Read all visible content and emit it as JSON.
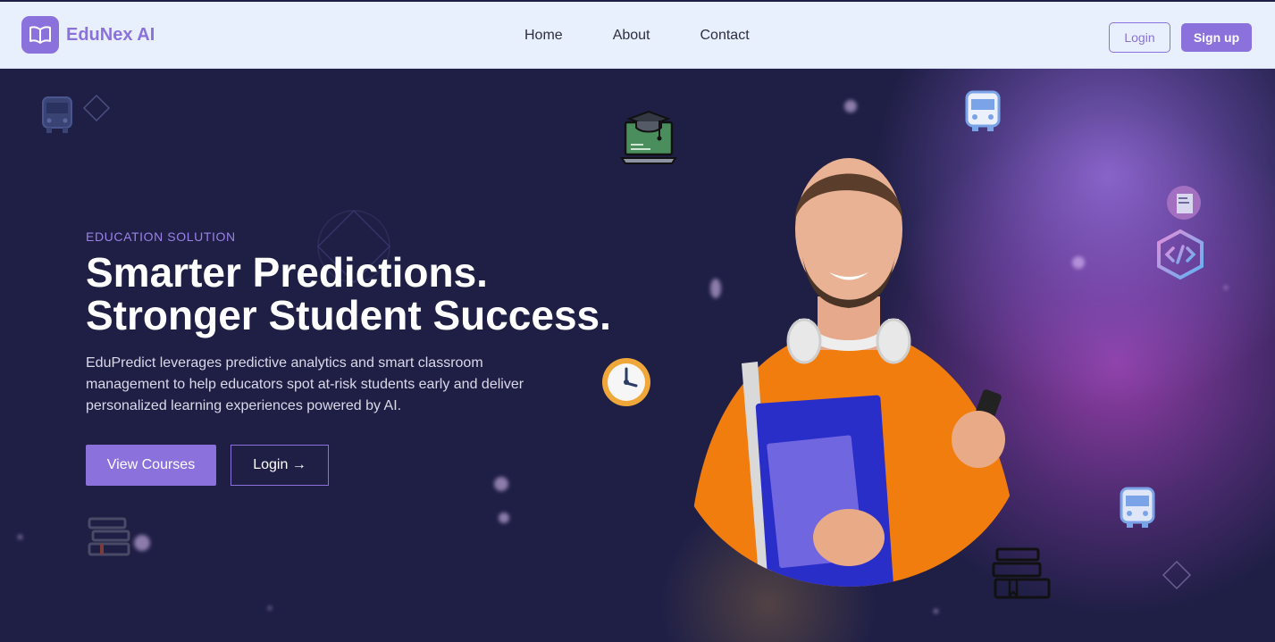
{
  "brand": {
    "name": "EduNex AI",
    "logo_icon": "open-book-icon",
    "accent": "#8b71dc"
  },
  "nav": {
    "links": [
      "Home",
      "About",
      "Contact"
    ],
    "login_label": "Login",
    "signup_label": "Sign up"
  },
  "hero": {
    "eyebrow": "EDUCATION SOLUTION",
    "headline_line1": "Smarter Predictions.",
    "headline_line2": "Stronger Student Success.",
    "description": "EduPredict leverages predictive analytics and smart classroom management to help educators spot at-risk students early and deliver personalized learning experiences powered by AI.",
    "primary_cta": "View Courses",
    "secondary_cta": "Login →",
    "background": "#1f1f46"
  },
  "decorations": [
    "bus-icon",
    "diamond-icon",
    "graduation-laptop-icon",
    "clock-icon",
    "book-stack-icon",
    "code-hexagon-icon",
    "student-photo"
  ]
}
